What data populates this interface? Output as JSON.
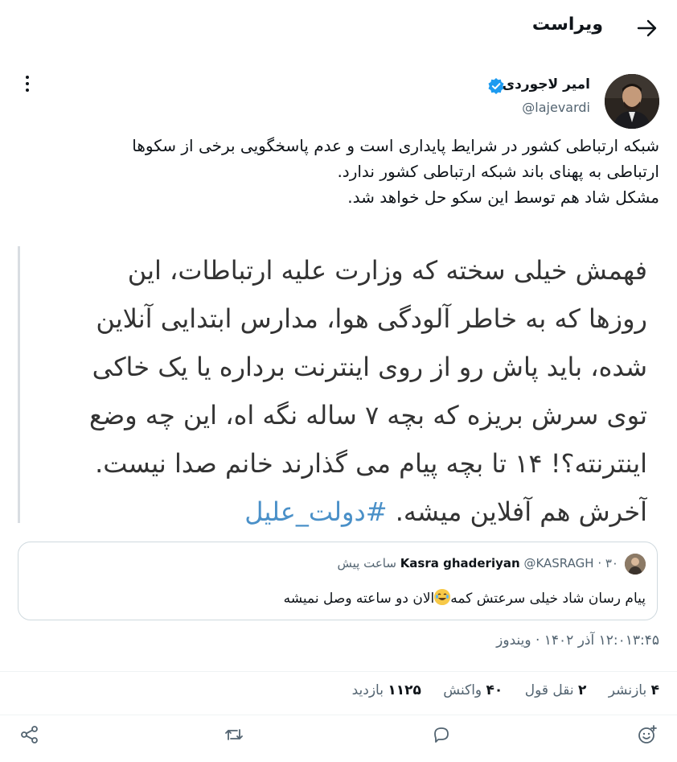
{
  "header": {
    "title": "ویراست",
    "back_icon": "arrow-right-icon"
  },
  "author": {
    "name": "امیر لاجوردی",
    "handle": "@lajevardi",
    "verified_icon": "verified-badge-icon",
    "verified_color": "#1d9bf0"
  },
  "tweet": {
    "lines": [
      "شبکه ارتباطی کشور در شرایط پایداری است و عدم پاسخگویی برخی از سکوها",
      "ارتباطی به پهنای باند شبکه ارتباطی کشور ندارد.",
      "مشکل شاد هم توسط این سکو حل خواهد شد."
    ]
  },
  "image": {
    "lines": [
      "فهمش خیلی سخته که وزارت علیه ارتباطات، این",
      "روزها که به خاطر آلودگی هوا، مدارس ابتدایی آنلاین",
      "شده، باید پاش رو از روی اینترنت برداره یا یک خاکی",
      "توی سرش بریزه که بچه ۷ ساله نگه اه، این چه وضع",
      "اینترنته؟! ۱۴ تا بچه پیام می گذارند خانم صدا نیست.",
      "آخرش هم آفلاین میشه."
    ],
    "hashtag": "#دولت_علیل"
  },
  "quote": {
    "name": "Kasra ghaderiyan",
    "handle": "@KASRAGH",
    "separator": "·",
    "time": "۳۰ ساعت پیش",
    "text_before": "پیام رسان شاد خیلی سرعتش کمه",
    "emoji_icon": "laughing-emoji-icon",
    "text_after": "الان دو ساعته وصل نمیشه"
  },
  "timestamp": "۱۲:۰۱۳:۴۵ آذر ۱۴۰۲ · ویندوز",
  "stats": [
    {
      "num": "۴",
      "label": "بازنشر"
    },
    {
      "num": "۲",
      "label": "نقل قول"
    },
    {
      "num": "۴۰",
      "label": "واکنش"
    },
    {
      "num": "۱۱۲۵",
      "label": "بازدید"
    }
  ],
  "actions": [
    "add-reaction-icon",
    "reply-icon",
    "retweet-icon",
    "share-icon"
  ],
  "colors": {
    "text": "#0f1419",
    "secondary": "#536471",
    "hashtag": "#4a90c8",
    "divider": "#eff3f4"
  }
}
